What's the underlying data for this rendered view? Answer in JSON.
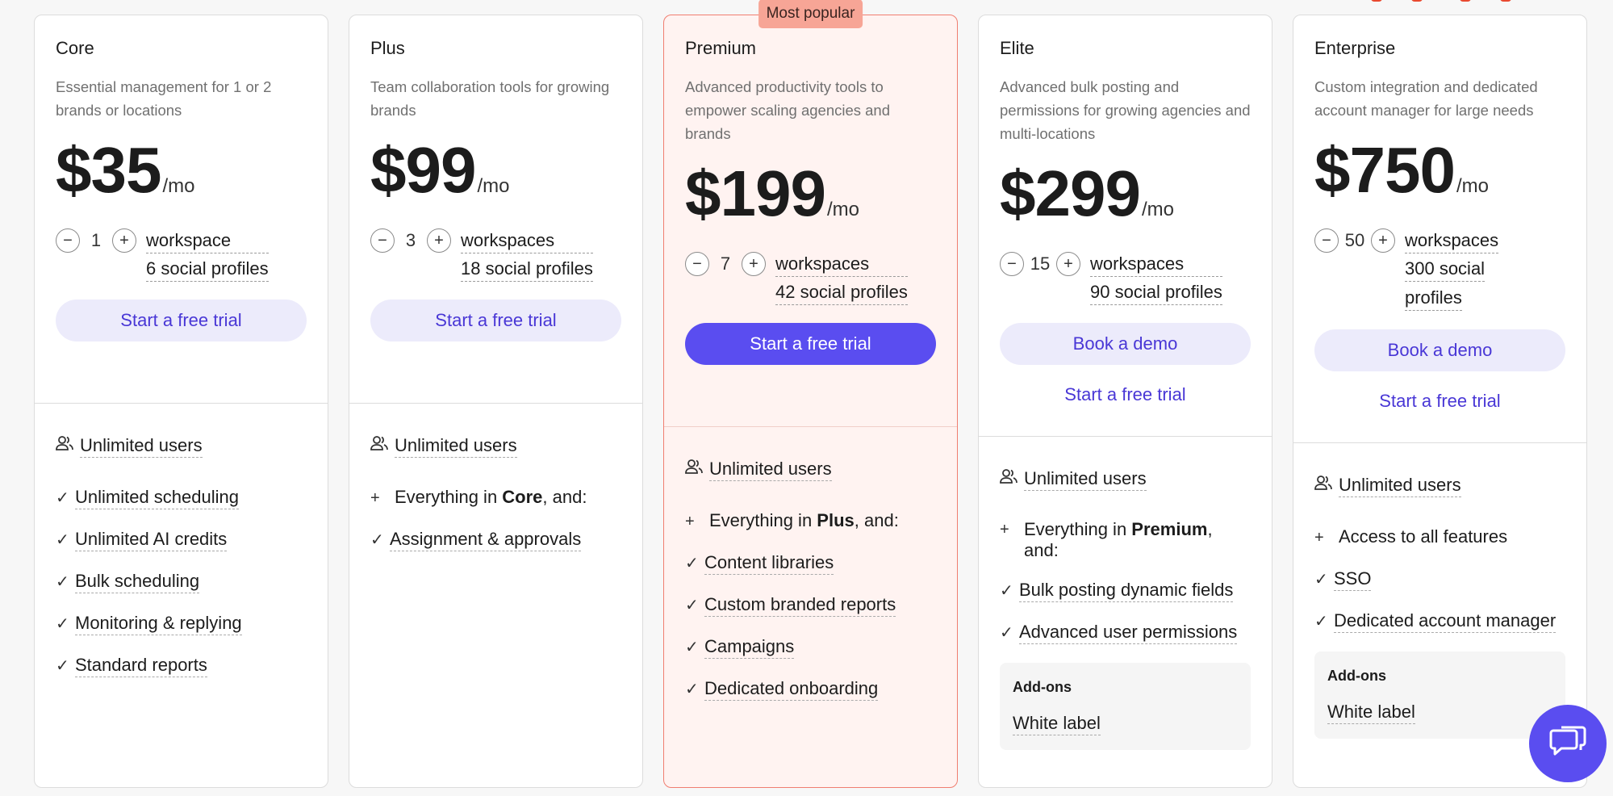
{
  "badge": "Most popular",
  "plans": [
    {
      "name": "Core",
      "description": "Essential management for 1 or 2 brands or locations",
      "price": "$35",
      "per": "/mo",
      "count": "1",
      "workspaces_label": "workspace",
      "profiles_label": "6 social profiles",
      "primary_button": "Start a free trial",
      "users": "Unlimited users",
      "features": [
        "Unlimited scheduling",
        "Unlimited AI credits",
        "Bulk scheduling",
        "Monitoring & replying",
        "Standard reports"
      ]
    },
    {
      "name": "Plus",
      "description": "Team collaboration tools for growing brands",
      "price": "$99",
      "per": "/mo",
      "count": "3",
      "workspaces_label": "workspaces",
      "profiles_label": "18 social profiles",
      "primary_button": "Start a free trial",
      "users": "Unlimited users",
      "everything_prefix": "Everything in ",
      "everything_plan": "Core",
      "everything_suffix": ", and:",
      "features": [
        "Assignment & approvals"
      ]
    },
    {
      "name": "Premium",
      "description": "Advanced productivity tools to empower scaling agencies and brands",
      "price": "$199",
      "per": "/mo",
      "count": "7",
      "workspaces_label": "workspaces",
      "profiles_label": "42 social profiles",
      "primary_button": "Start a free trial",
      "users": "Unlimited users",
      "everything_prefix": "Everything in ",
      "everything_plan": "Plus",
      "everything_suffix": ", and:",
      "features": [
        "Content libraries",
        "Custom branded reports",
        "Campaigns",
        "Dedicated onboarding"
      ]
    },
    {
      "name": "Elite",
      "description": "Advanced bulk posting and permissions for growing agencies and multi-locations",
      "price": "$299",
      "per": "/mo",
      "count": "15",
      "workspaces_label": "workspaces",
      "profiles_label": "90 social profiles",
      "primary_button": "Book a demo",
      "secondary_button": "Start a free trial",
      "users": "Unlimited users",
      "everything_prefix": "Everything in ",
      "everything_plan": "Premium",
      "everything_suffix": ",",
      "everything_line2": "and:",
      "features": [
        "Bulk posting dynamic fields",
        "Advanced user permissions"
      ],
      "addons_title": "Add-ons",
      "addons_item": "White label"
    },
    {
      "name": "Enterprise",
      "description": "Custom integration and dedicated account manager for large needs",
      "price": "$750",
      "per": "/mo",
      "count": "50",
      "workspaces_label": "workspaces",
      "profiles_label_1": "300 social",
      "profiles_label_2": "profiles",
      "primary_button": "Book a demo",
      "secondary_button": "Start a free trial",
      "users": "Unlimited users",
      "access": "Access to all features",
      "features": [
        "SSO",
        "Dedicated account manager"
      ],
      "addons_title": "Add-ons",
      "addons_item": "White label"
    }
  ],
  "colors": {
    "accent": "#5a4df0",
    "accent_text": "#4937d6",
    "popular_bg": "#fff3f1",
    "popular_border": "#f07e70",
    "badge_bg": "#f7a596"
  },
  "icons": {
    "minus": "minus-icon",
    "plus": "plus-icon",
    "users": "users-icon",
    "check": "check-icon",
    "chat": "chat-icon"
  }
}
